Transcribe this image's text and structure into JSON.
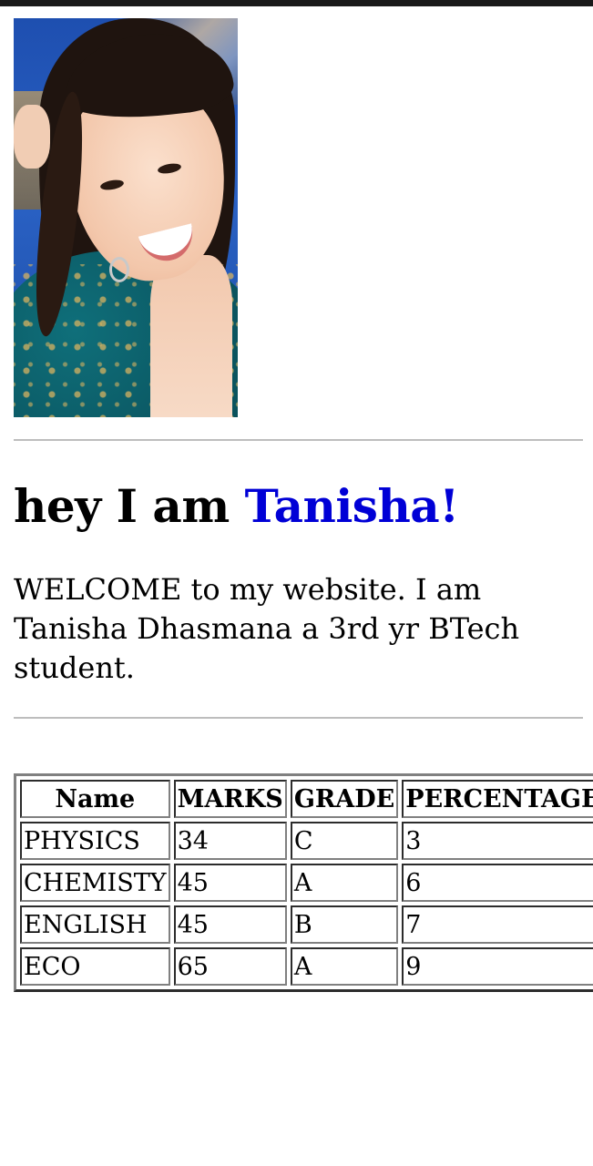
{
  "profile": {
    "photo_icon": "portrait-photo"
  },
  "heading": {
    "prefix": "hey I am ",
    "name": "Tanisha!",
    "name_color": "#0000d6"
  },
  "intro": "WELCOME to my website. I am Tanisha Dhasmana a 3rd yr BTech student.",
  "table": {
    "headers": [
      "Name",
      "MARKS",
      "GRADE",
      "PERCENTAGE"
    ],
    "rows": [
      [
        "PHYSICS",
        "34",
        "C",
        "3"
      ],
      [
        "CHEMISTY",
        "45",
        "A",
        "6"
      ],
      [
        "ENGLISH",
        "45",
        "B",
        "7"
      ],
      [
        "ECO",
        "65",
        "A",
        "9"
      ]
    ]
  }
}
